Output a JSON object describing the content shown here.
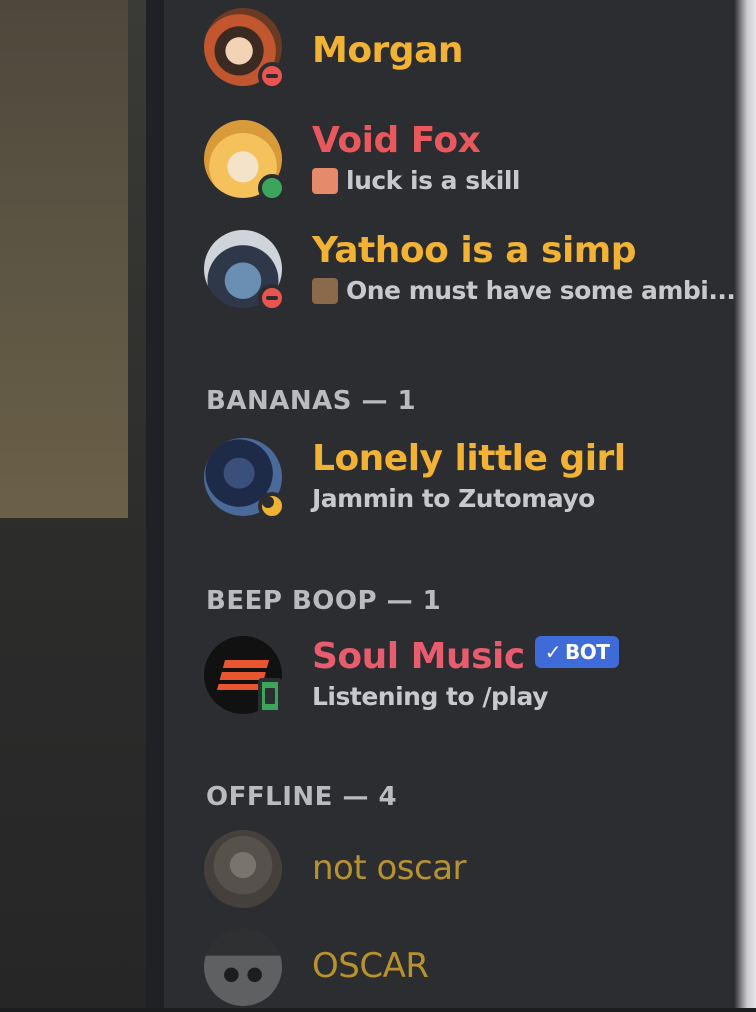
{
  "colors": {
    "gold": "#f2b233",
    "red": "#e8585c",
    "pink": "#e85c6e",
    "offline_gold": "#b7922e",
    "header": "#b9bbbe",
    "bot_badge": "#3f6bd8"
  },
  "members_top": [
    {
      "name": "Morgan",
      "status": "dnd",
      "activity": ""
    },
    {
      "name": "Void Fox",
      "status": "online",
      "activity": "luck is a skill"
    },
    {
      "name": "Yathoo is a simp",
      "status": "dnd",
      "activity": "One must have some ambi..."
    }
  ],
  "groups": [
    {
      "header": "BANANAS — 1",
      "members": [
        {
          "name": "Lonely little girl",
          "status": "idle",
          "activity": "Jammin to Zutomayo"
        }
      ]
    },
    {
      "header": "BEEP BOOP — 1",
      "members": [
        {
          "name": "Soul Music",
          "status": "mobile",
          "activity": "Listening to /play",
          "badge": "BOT",
          "badge_icon": "checkmark-icon"
        }
      ]
    },
    {
      "header": "OFFLINE — 4",
      "members": [
        {
          "name": "not oscar",
          "status": "offline",
          "activity": ""
        },
        {
          "name": "OSCAR",
          "status": "offline",
          "activity": ""
        }
      ]
    }
  ]
}
